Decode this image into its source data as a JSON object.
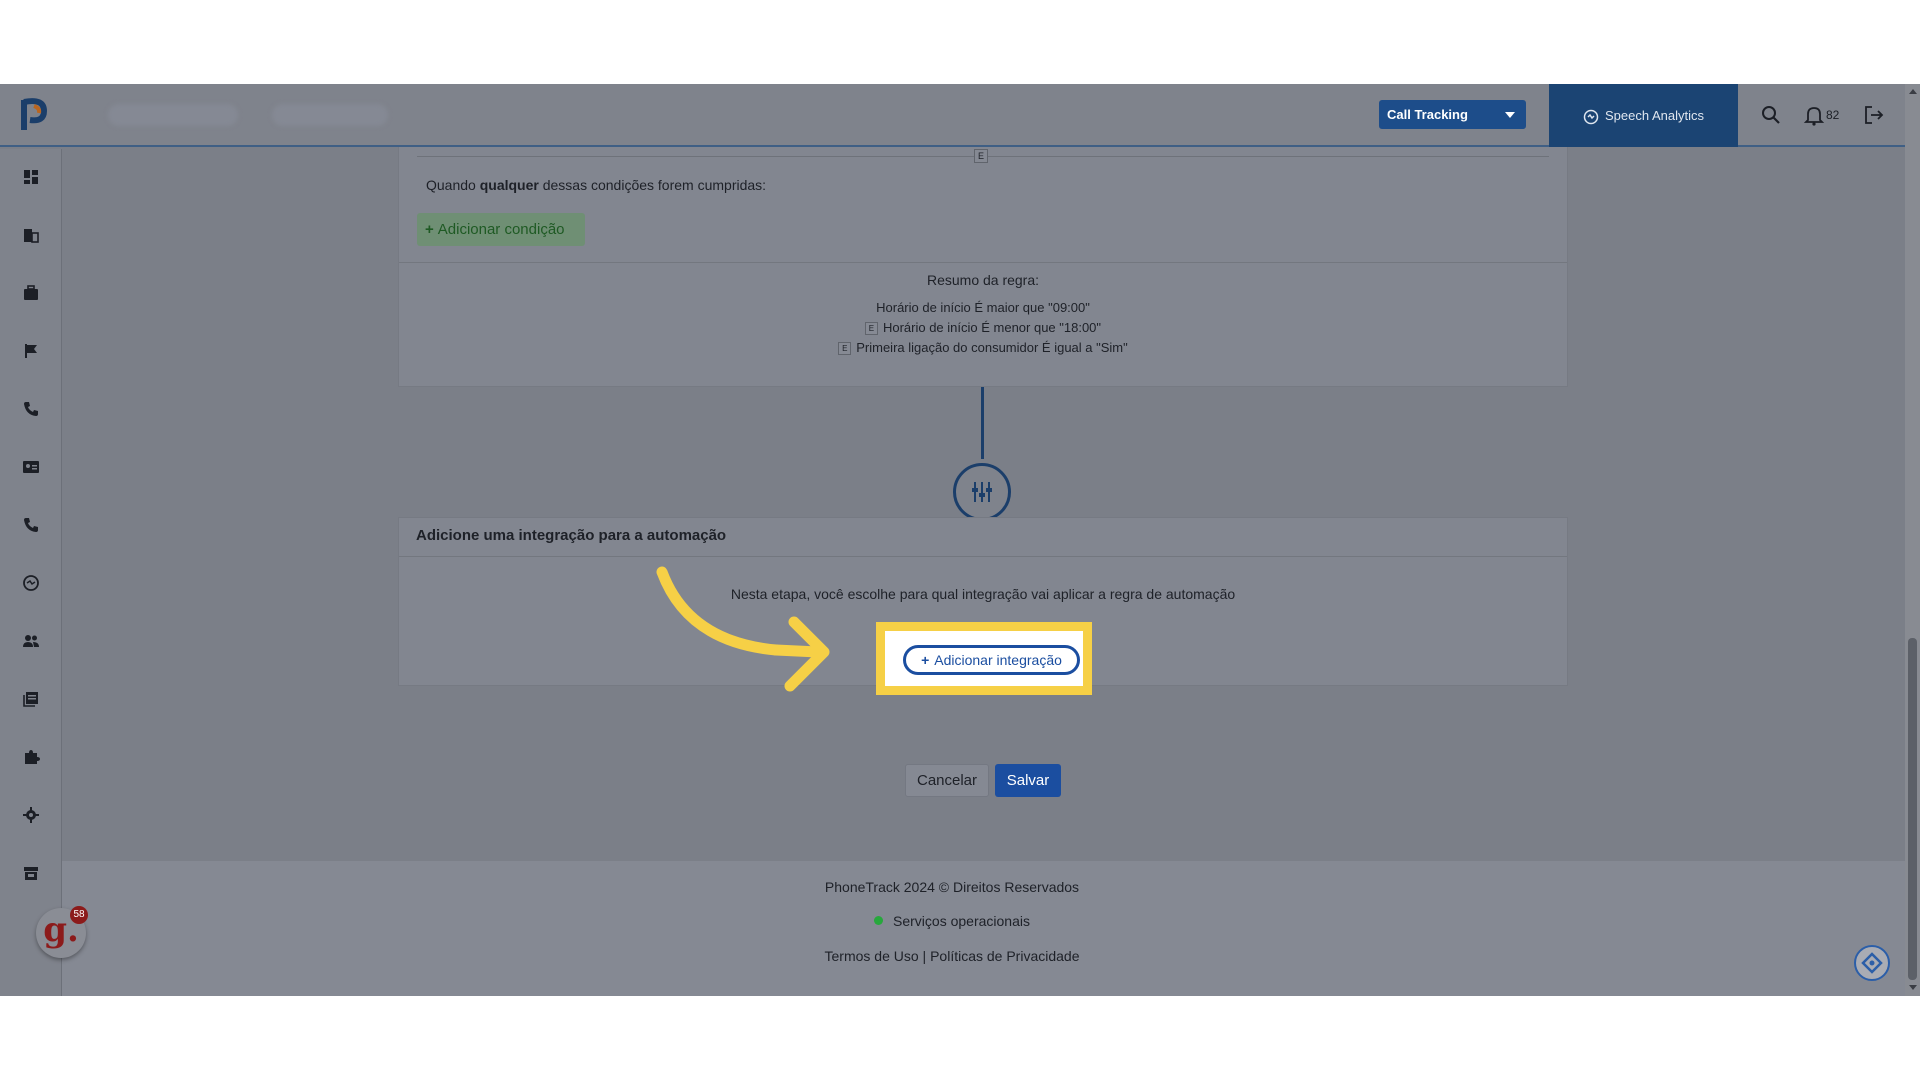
{
  "header": {
    "call_tracking_label": "Call Tracking",
    "speech_analytics_label": "Speech Analytics",
    "notification_count": "82"
  },
  "rule": {
    "e_label": "E",
    "when_prefix": "Quando ",
    "when_emphasis": "qualquer",
    "when_suffix": " dessas condições forem cumpridas:",
    "add_condition_label": "Adicionar condição",
    "summary_title": "Resumo da regra:",
    "summary_lines": [
      "Horário de início É maior que \"09:00\"",
      "Horário de início É menor que \"18:00\"",
      "Primeira ligação do consumidor É igual a \"Sim\""
    ]
  },
  "integration": {
    "header": "Adicione uma integração para a automação",
    "description": "Nesta etapa, você escolhe para qual integração vai aplicar a regra de automação",
    "add_integration_label": "Adicionar integração"
  },
  "actions": {
    "cancel_label": "Cancelar",
    "save_label": "Salvar"
  },
  "footer": {
    "copyright": "PhoneTrack 2024 © Direitos Reservados",
    "status": "Serviços operacionais",
    "terms": "Termos de Uso",
    "separator": " | ",
    "privacy": "Políticas de Privacidade"
  },
  "widget": {
    "avatar_letter": "g.",
    "badge_count": "58"
  },
  "colors": {
    "accent": "#1b4ea0",
    "highlight": "#f6d046",
    "status_ok": "#27a83c"
  }
}
